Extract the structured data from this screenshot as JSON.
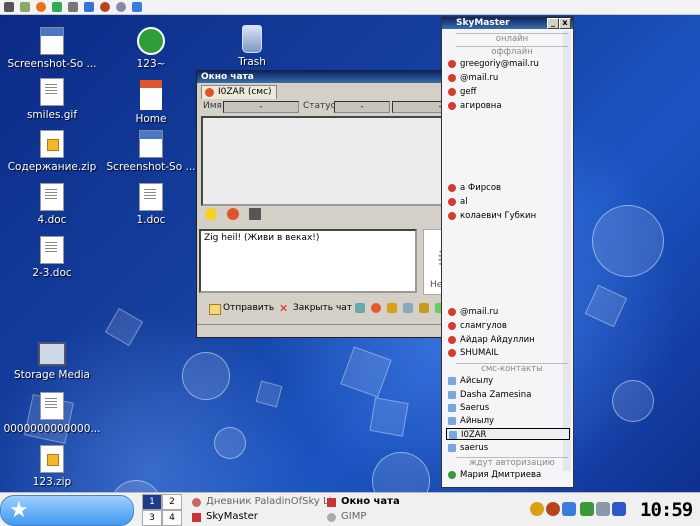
{
  "desktop": {
    "icons": [
      {
        "label": "Screenshot-So ...",
        "icon": "screenshot-icon"
      },
      {
        "label": "123~",
        "icon": "green-circle-icon"
      },
      {
        "label": "Trash",
        "icon": "trash-icon"
      },
      {
        "label": "smiles.gif",
        "icon": "document-icon"
      },
      {
        "label": "Home",
        "icon": "home-icon"
      },
      {
        "label": "Содержание.zip",
        "icon": "zip-icon"
      },
      {
        "label": "Screenshot-So ...",
        "icon": "screenshot-icon"
      },
      {
        "label": "4.doc",
        "icon": "document-icon"
      },
      {
        "label": "1.doc",
        "icon": "document-icon"
      },
      {
        "label": "2-3.doc",
        "icon": "document-icon"
      },
      {
        "label": "Storage Media",
        "icon": "monitor-icon"
      },
      {
        "label": "0000000000000...",
        "icon": "document-icon"
      },
      {
        "label": "123.zip",
        "icon": "zip-icon"
      }
    ]
  },
  "chat": {
    "title": "Окно чата",
    "tab": "I0ZAR (смс)",
    "name_label": "Имя:",
    "name_value": "-",
    "status_label": "Статус:",
    "status_value": "-",
    "extra_value": "-",
    "message_text": "Zig heil! (Живи в веках!)",
    "avatar_caption": "Нет Фото",
    "send_label": "Отправить",
    "close_label": "Закрыть чат"
  },
  "skymaster": {
    "title": "SkyMaster",
    "groups": {
      "online": "онлайн",
      "offline": "оффлайн",
      "sms": "смс-контакты",
      "auth": "ждут авторизацию"
    },
    "offline_contacts": [
      "greegoriy@mail.ru",
      "@mail.ru",
      "geff",
      "агировна",
      "а Фирсов",
      "al",
      "колаевич Губкин",
      "@mail.ru",
      "сламгулов",
      "Айдар Айдуллин",
      "SHUMAIL"
    ],
    "sms_contacts": [
      "Айсылу",
      "Dasha Zamesina",
      "Saerus",
      "Айнылу",
      "I0ZAR",
      "saerus"
    ],
    "auth_contacts": [
      "Мария Дмитриева"
    ]
  },
  "taskbar": {
    "pages": [
      "1",
      "2",
      "3",
      "4"
    ],
    "tasks": [
      "Дневник PaladinOfSky Live...",
      "Окно чата",
      "SkyMaster",
      "GIMP"
    ],
    "clock": "10:59"
  }
}
